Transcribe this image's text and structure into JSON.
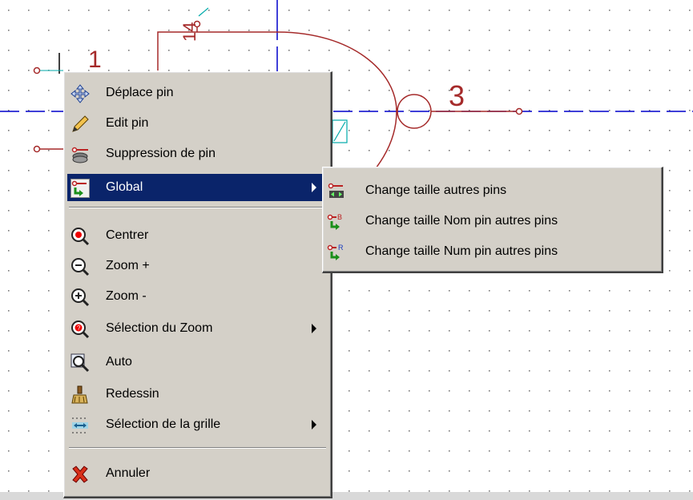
{
  "schematic": {
    "pin_numbers": [
      "1",
      "3"
    ],
    "pin_name_fragment": "14"
  },
  "context_menu": {
    "items": [
      {
        "label": "Déplace pin",
        "icon": "move-arrows-icon"
      },
      {
        "label": "Edit pin",
        "icon": "pencil-icon"
      },
      {
        "label": "Suppression de pin",
        "icon": "delete-pin-icon"
      },
      {
        "label": "Global",
        "icon": "global-pin-icon",
        "highlighted": true,
        "has_submenu": true
      },
      {
        "label": "Centrer",
        "icon": "zoom-center-icon"
      },
      {
        "label": "Zoom +",
        "icon": "zoom-in-icon"
      },
      {
        "label": "Zoom -",
        "icon": "zoom-out-icon"
      },
      {
        "label": "Sélection du Zoom",
        "icon": "zoom-select-icon",
        "has_submenu": true
      },
      {
        "label": "Auto",
        "icon": "zoom-auto-icon"
      },
      {
        "label": "Redessin",
        "icon": "redraw-brush-icon"
      },
      {
        "label": "Sélection de la grille",
        "icon": "grid-select-icon",
        "has_submenu": true
      },
      {
        "label": "Annuler",
        "icon": "cancel-x-icon"
      }
    ]
  },
  "submenu": {
    "items": [
      {
        "label": "Change taille autres pins",
        "icon": "pin-size-icon"
      },
      {
        "label": "Change taille Nom pin autres pins",
        "icon": "pin-name-size-icon"
      },
      {
        "label": "Change taille Num pin autres pins",
        "icon": "pin-num-size-icon"
      }
    ]
  },
  "colors": {
    "menu_bg": "#d4d0c8",
    "highlight": "#0a246a",
    "wire": "#a52a2a",
    "axis": "#0000cc",
    "grid_dot": "#7a7a7a"
  }
}
